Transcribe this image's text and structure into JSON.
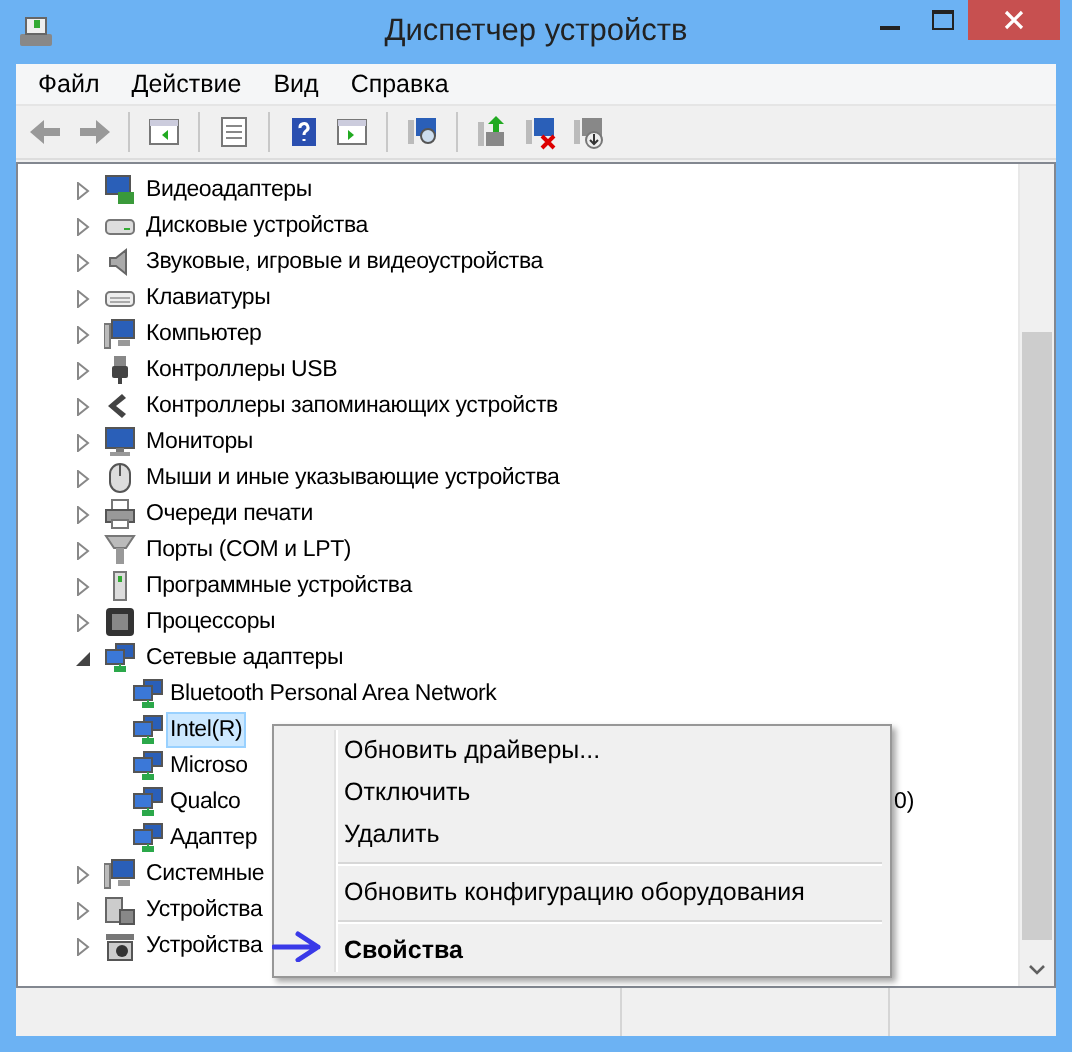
{
  "window": {
    "title": "Диспетчер устройств"
  },
  "menu_bar": [
    "Файл",
    "Действие",
    "Вид",
    "Справка"
  ],
  "tree": [
    {
      "label": "Видеоадаптеры",
      "expanded": false,
      "selected": false
    },
    {
      "label": "Дисковые устройства",
      "expanded": false,
      "selected": false
    },
    {
      "label": "Звуковые, игровые и видеоустройства",
      "expanded": false,
      "selected": false
    },
    {
      "label": "Клавиатуры",
      "expanded": false,
      "selected": false
    },
    {
      "label": "Компьютер",
      "expanded": false,
      "selected": false
    },
    {
      "label": "Контроллеры USB",
      "expanded": false,
      "selected": false
    },
    {
      "label": "Контроллеры запоминающих устройств",
      "expanded": false,
      "selected": false
    },
    {
      "label": "Мониторы",
      "expanded": false,
      "selected": false
    },
    {
      "label": "Мыши и иные указывающие устройства",
      "expanded": false,
      "selected": false
    },
    {
      "label": "Очереди печати",
      "expanded": false,
      "selected": false
    },
    {
      "label": "Порты (COM и LPT)",
      "expanded": false,
      "selected": false
    },
    {
      "label": "Программные устройства",
      "expanded": false,
      "selected": false
    },
    {
      "label": "Процессоры",
      "expanded": false,
      "selected": false
    },
    {
      "label": "Сетевые адаптеры",
      "expanded": true,
      "selected": false,
      "children": [
        {
          "label": "Bluetooth Personal Area Network",
          "selected": false
        },
        {
          "label": "Intel(R)",
          "selected": true
        },
        {
          "label": "Microso",
          "selected": false
        },
        {
          "label": "Qualco",
          "tail": "0)",
          "selected": false
        },
        {
          "label": "Адаптер",
          "selected": false
        }
      ]
    },
    {
      "label": "Системные",
      "expanded": false,
      "selected": false
    },
    {
      "label": "Устройства",
      "expanded": false,
      "selected": false
    },
    {
      "label": "Устройства",
      "expanded": false,
      "selected": false
    }
  ],
  "context_menu": [
    {
      "kind": "item",
      "label": "Обновить драйверы...",
      "default": false
    },
    {
      "kind": "item",
      "label": "Отключить",
      "default": false
    },
    {
      "kind": "item",
      "label": "Удалить",
      "default": false
    },
    {
      "kind": "separator"
    },
    {
      "kind": "item",
      "label": "Обновить конфигурацию оборудования",
      "default": false
    },
    {
      "kind": "separator"
    },
    {
      "kind": "item",
      "label": "Свойства",
      "default": true
    }
  ]
}
